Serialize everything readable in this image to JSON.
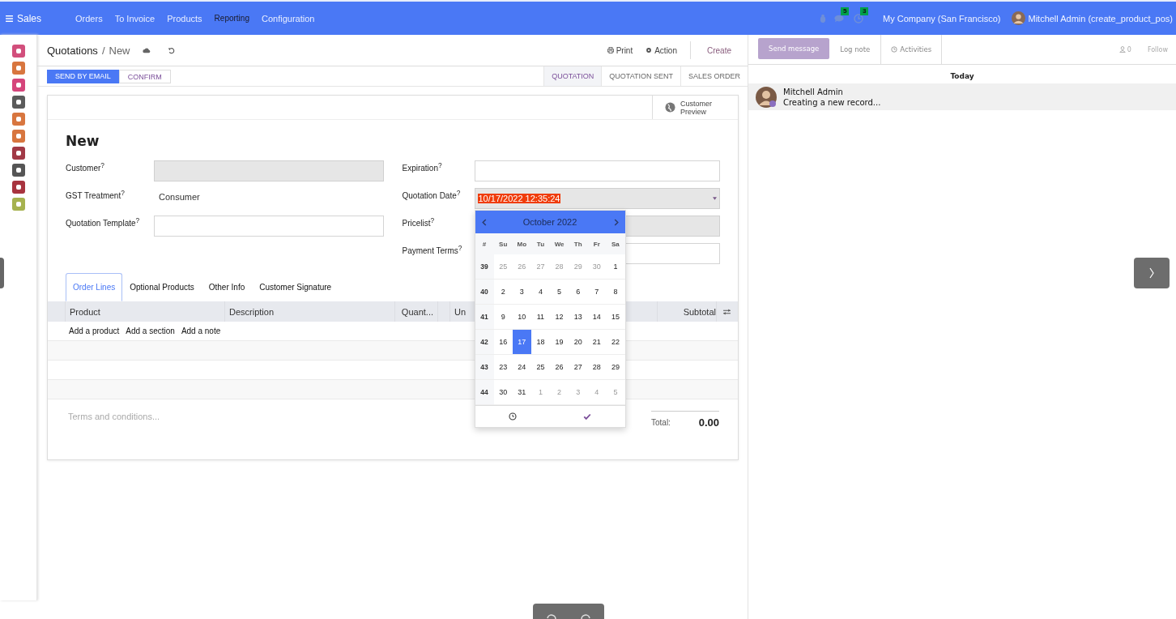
{
  "top_bar": {
    "app": "Sales",
    "menu": [
      {
        "label": "Orders",
        "selected": false
      },
      {
        "label": "To Invoice",
        "selected": false
      },
      {
        "label": "Products",
        "selected": false
      },
      {
        "label": "Reporting",
        "selected": true
      },
      {
        "label": "Configuration",
        "selected": false
      }
    ],
    "messages_count": "5",
    "activities_count": "3",
    "company": "My Company (San Francisco)",
    "user": "Mitchell Admin (create_product_pos)"
  },
  "apps": [
    {
      "color": "#d24f7c"
    },
    {
      "color": "#d8763f"
    },
    {
      "color": "#d5457b"
    },
    {
      "color": "#5b5b5b"
    },
    {
      "color": "#d8763f"
    },
    {
      "color": "#d8763f"
    },
    {
      "color": "#a13946"
    },
    {
      "color": "#555555"
    },
    {
      "color": "#a8343f"
    },
    {
      "color": "#a6b24f"
    }
  ],
  "breadcrumb": {
    "parent": "Quotations",
    "separator": "/",
    "current": "New"
  },
  "actions": {
    "print": "Print",
    "action": "Action",
    "create": "Create"
  },
  "buttons": [
    {
      "label": "SEND BY EMAIL",
      "kind": "primary"
    },
    {
      "label": "CONFIRM",
      "kind": "secondary"
    }
  ],
  "stages": [
    {
      "label": "QUOTATION",
      "selected": true
    },
    {
      "label": "QUOTATION SENT",
      "selected": false
    },
    {
      "label": "SALES ORDER",
      "selected": false
    }
  ],
  "smart_button": "Customer Preview",
  "title": "New",
  "left_fields": [
    {
      "label": "Customer$^{?}$",
      "kind": "input",
      "required": true
    },
    {
      "label": "GST Treatment$^{?}$",
      "kind": "text",
      "value": "Consumer"
    },
    {
      "label": "Quotation Template$^{?}$",
      "kind": "input",
      "required": false
    }
  ],
  "right_fields": [
    {
      "label": "Expiration$^{?}$",
      "kind": "input",
      "required": false
    },
    {
      "label": "Quotation Date$^{?}$",
      "kind": "date",
      "value": "10/17/2022 12:35:24"
    },
    {
      "label": "Pricelist$^{?}$",
      "kind": "input",
      "required": true
    },
    {
      "label": "Payment Terms$^{?}$",
      "kind": "input",
      "required": false
    }
  ],
  "calendar": {
    "month": "October 2022",
    "week_header": "#",
    "day_names": [
      "Su",
      "Mo",
      "Tu",
      "We",
      "Th",
      "Fr",
      "Sa"
    ],
    "weeks": [
      {
        "week": "39",
        "days": [
          {
            "text": "25",
            "outside": true,
            "selected": false
          },
          {
            "text": "26",
            "outside": true,
            "selected": false
          },
          {
            "text": "27",
            "outside": true,
            "selected": false
          },
          {
            "text": "28",
            "outside": true,
            "selected": false
          },
          {
            "text": "29",
            "outside": true,
            "selected": false
          },
          {
            "text": "30",
            "outside": true,
            "selected": false
          },
          {
            "text": "1",
            "outside": false,
            "selected": false
          }
        ]
      },
      {
        "week": "40",
        "days": [
          {
            "text": "2",
            "outside": false,
            "selected": false
          },
          {
            "text": "3",
            "outside": false,
            "selected": false
          },
          {
            "text": "4",
            "outside": false,
            "selected": false
          },
          {
            "text": "5",
            "outside": false,
            "selected": false
          },
          {
            "text": "6",
            "outside": false,
            "selected": false
          },
          {
            "text": "7",
            "outside": false,
            "selected": false
          },
          {
            "text": "8",
            "outside": false,
            "selected": false
          }
        ]
      },
      {
        "week": "41",
        "days": [
          {
            "text": "9",
            "outside": false,
            "selected": false
          },
          {
            "text": "10",
            "outside": false,
            "selected": false
          },
          {
            "text": "11",
            "outside": false,
            "selected": false
          },
          {
            "text": "12",
            "outside": false,
            "selected": false
          },
          {
            "text": "13",
            "outside": false,
            "selected": false
          },
          {
            "text": "14",
            "outside": false,
            "selected": false
          },
          {
            "text": "15",
            "outside": false,
            "selected": false
          }
        ]
      },
      {
        "week": "42",
        "days": [
          {
            "text": "16",
            "outside": false,
            "selected": false
          },
          {
            "text": "17",
            "outside": false,
            "selected": true
          },
          {
            "text": "18",
            "outside": false,
            "selected": false
          },
          {
            "text": "19",
            "outside": false,
            "selected": false
          },
          {
            "text": "20",
            "outside": false,
            "selected": false
          },
          {
            "text": "21",
            "outside": false,
            "selected": false
          },
          {
            "text": "22",
            "outside": false,
            "selected": false
          }
        ]
      },
      {
        "week": "43",
        "days": [
          {
            "text": "23",
            "outside": false,
            "selected": false
          },
          {
            "text": "24",
            "outside": false,
            "selected": false
          },
          {
            "text": "25",
            "outside": false,
            "selected": false
          },
          {
            "text": "26",
            "outside": false,
            "selected": false
          },
          {
            "text": "27",
            "outside": false,
            "selected": false
          },
          {
            "text": "28",
            "outside": false,
            "selected": false
          },
          {
            "text": "29",
            "outside": false,
            "selected": false
          }
        ]
      },
      {
        "week": "44",
        "days": [
          {
            "text": "30",
            "outside": false,
            "selected": false
          },
          {
            "text": "31",
            "outside": false,
            "selected": false
          },
          {
            "text": "1",
            "outside": true,
            "selected": false
          },
          {
            "text": "2",
            "outside": true,
            "selected": false
          },
          {
            "text": "3",
            "outside": true,
            "selected": false
          },
          {
            "text": "4",
            "outside": true,
            "selected": false
          },
          {
            "text": "5",
            "outside": true,
            "selected": false
          }
        ]
      }
    ]
  },
  "tabs": [
    {
      "label": "Order Lines",
      "selected": true
    },
    {
      "label": "Optional Products",
      "selected": false
    },
    {
      "label": "Other Info",
      "selected": false
    },
    {
      "label": "Customer Signature",
      "selected": false
    }
  ],
  "table": {
    "columns": [
      "Product",
      "Description",
      "Quant...",
      "Un",
      "Subtotal"
    ],
    "add_links": [
      "Add a product",
      "Add a section",
      "Add a note"
    ]
  },
  "terms_placeholder": "Terms and conditions...",
  "total": {
    "label": "Total:",
    "value": "0.00"
  },
  "chatter": {
    "tabs": [
      {
        "label": "Send message",
        "selected": true
      },
      {
        "label": "Log note",
        "selected": false
      },
      {
        "label": "Activities",
        "selected": false
      }
    ],
    "followers": "0",
    "follow": "Follow",
    "date": "Today",
    "messages": [
      {
        "author": "Mitchell Admin",
        "body": "Creating a new record..."
      }
    ]
  }
}
